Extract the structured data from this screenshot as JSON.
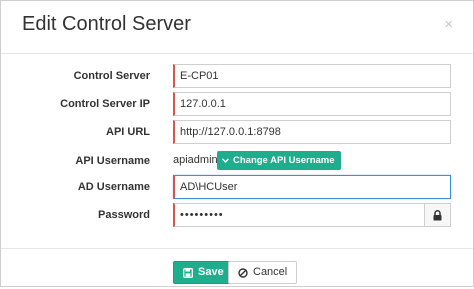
{
  "dialog": {
    "title": "Edit Control Server",
    "close_glyph": "×"
  },
  "fields": {
    "control_server": {
      "label": "Control Server",
      "value": "E-CP01"
    },
    "control_server_ip": {
      "label": "Control Server IP",
      "value": "127.0.0.1"
    },
    "api_url": {
      "label": "API URL",
      "value": "http://127.0.0.1:8798"
    },
    "api_username": {
      "label": "API Username",
      "value": "apiadmin",
      "change_label": "Change API Username"
    },
    "ad_username": {
      "label": "AD Username",
      "value": "AD\\HCUser"
    },
    "password": {
      "label": "Password",
      "value": "•••••••••"
    }
  },
  "footer": {
    "save_label": "Save",
    "cancel_label": "Cancel"
  },
  "colors": {
    "accent": "#1fae8d",
    "required_marker": "#d9534f",
    "focus": "#3a8fd9"
  },
  "icons": {
    "close": "close-icon",
    "lock": "lock-icon",
    "change": "chevron-down-icon",
    "save": "save-icon",
    "cancel": "ban-icon"
  }
}
